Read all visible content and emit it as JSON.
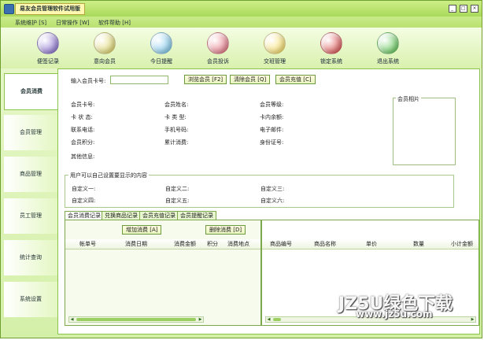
{
  "window": {
    "title": "易友会员管理软件试用版",
    "controls": [
      "_",
      "□",
      "×"
    ]
  },
  "menu": [
    "系统维护 [S]",
    "日常操作 [W]",
    "软件帮助 [H]"
  ],
  "toolbar": [
    {
      "label": "便签记录",
      "icon": "note-icon",
      "color": "#7a5cc8"
    },
    {
      "label": "意向会员",
      "icon": "member-icon",
      "color": "#e8e070"
    },
    {
      "label": "今日提醒",
      "icon": "reminder-icon",
      "color": "#6cc0e8"
    },
    {
      "label": "会员投诉",
      "icon": "complaint-icon",
      "color": "#e06070"
    },
    {
      "label": "交班管理",
      "icon": "shift-icon",
      "color": "#f4d850"
    },
    {
      "label": "锁定系统",
      "icon": "lock-icon",
      "color": "#d83a3a"
    },
    {
      "label": "退出系统",
      "icon": "exit-icon",
      "color": "#4cc040"
    }
  ],
  "sidebar": [
    "会员消费",
    "会员管理",
    "商品管理",
    "员工管理",
    "统计查询",
    "系统设置"
  ],
  "card": {
    "label": "输入会员卡号:",
    "value": "",
    "buttons": [
      "浏览会员 [F2]",
      "清除会员 [Q]",
      "会员充值 [C]"
    ]
  },
  "info": {
    "col1": [
      "会员卡号:",
      "卡 状 态:",
      "联系电话:",
      "会员积分:",
      "其他信息:"
    ],
    "col2": [
      "会员姓名:",
      "卡 类 型:",
      "手机号码:",
      "累计消费:"
    ],
    "col3": [
      "会员等级:",
      "卡内余额:",
      "电子邮件:",
      "身份证号:"
    ],
    "photo": "会员相片"
  },
  "custom": {
    "title": "用户可以自己设置要显示的内容",
    "fields": [
      "自定义一:",
      "自定义二:",
      "自定义三:",
      "自定义四:",
      "自定义五:",
      "自定义六:"
    ]
  },
  "tabs": [
    "会员消费记录",
    "兑换商品记录",
    "会员充值记录",
    "会员提醒记录"
  ],
  "actions": [
    "增加消费 [A]",
    "删除消费 [D]"
  ],
  "consume_columns": [
    "帐单号",
    "消费日期",
    "消费金额",
    "积分",
    "消费地点"
  ],
  "goods_columns": [
    "商品编号",
    "商品名称",
    "单价",
    "数量",
    "小计金额"
  ],
  "watermark": {
    "line1": "JZ5U绿色下载",
    "line2": "www.jz5u.com"
  }
}
